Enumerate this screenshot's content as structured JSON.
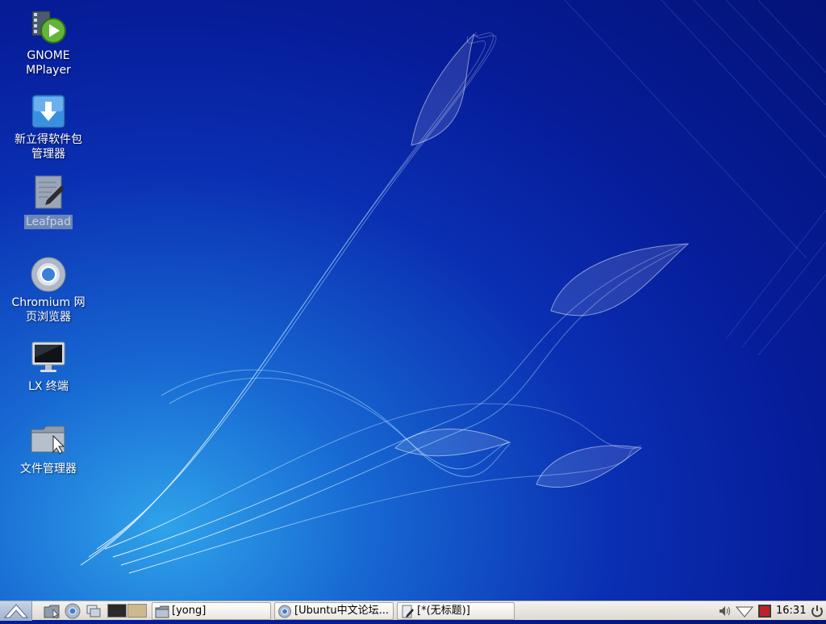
{
  "desktop": {
    "icons": [
      {
        "name": "gnome-mplayer",
        "label": "GNOME\nMPlayer",
        "icon": "media-player-icon"
      },
      {
        "name": "synaptic",
        "label": "新立得软件包\n管理器",
        "icon": "download-icon"
      },
      {
        "name": "leafpad",
        "label": "Leafpad",
        "icon": "text-editor-icon",
        "selected": true
      },
      {
        "name": "chromium",
        "label": "Chromium 网\n页浏览器",
        "icon": "chromium-icon"
      },
      {
        "name": "lxterminal",
        "label": "LX 终端",
        "icon": "monitor-icon"
      },
      {
        "name": "file-manager",
        "label": "文件管理器",
        "icon": "folder-icon"
      }
    ]
  },
  "taskbar": {
    "start_icon": "lxde-menu-icon",
    "launchers": [
      "file-manager-icon",
      "chromium-icon",
      "show-desktop-icon"
    ],
    "pager": {
      "desktops": 2,
      "active": 1
    },
    "tasks": [
      {
        "label": "[yong]",
        "icon": "folder-icon"
      },
      {
        "label": "[Ubuntu中文论坛...",
        "icon": "chromium-icon"
      },
      {
        "label": "[*(无标题)]",
        "icon": "text-editor-icon"
      }
    ],
    "tray": [
      "volume-icon",
      "network-icon",
      "record-icon"
    ],
    "clock": "16:31",
    "power_icon": "power-icon"
  },
  "colors": {
    "desktop_bg_dark": "#041378",
    "desktop_bg_light": "#2fa3ea",
    "taskbar_bg": "#ebe8e2",
    "selection": "#6b86b5"
  }
}
